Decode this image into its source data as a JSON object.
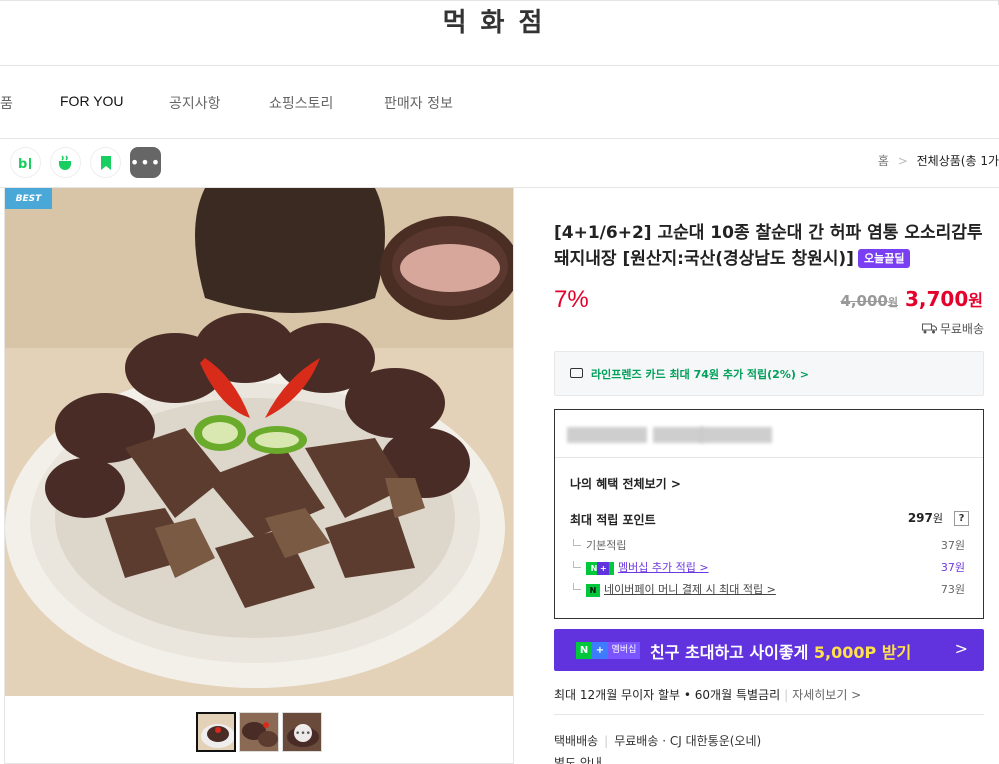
{
  "store": {
    "name": "먹화점"
  },
  "nav": {
    "items": [
      "품",
      "FOR YOU",
      "공지사항",
      "쇼핑스토리",
      "판매자 정보"
    ],
    "active_index": 1
  },
  "share_icons": [
    {
      "name": "blog-icon",
      "label": "b|"
    },
    {
      "name": "cafe-icon",
      "label": ""
    },
    {
      "name": "bookmark-icon",
      "label": ""
    },
    {
      "name": "more-icon",
      "label": "•••"
    }
  ],
  "breadcrumb": {
    "home": "홈",
    "current": "전체상품(총 1가"
  },
  "product": {
    "badge": "BEST",
    "title": "[4+1/6+2] 고순대 10종 찰순대 간 허파 염통 오소리감투 돼지내장 [원산지:국산(경상남도 창원시)]",
    "tag": "오늘끝딜",
    "discount": "7%",
    "original_price": "4,000",
    "original_price_unit": "원",
    "price": "3,700",
    "price_unit": "원",
    "shipping": "무료배송"
  },
  "card_promo": {
    "text": "라인프렌즈 카드 최대 74원 추가 적립(2%) >"
  },
  "benefits": {
    "view_all": "나의 혜택 전체보기 >",
    "max_points_label": "최대 적립 포인트",
    "max_points_value": "297",
    "max_points_unit": "원",
    "help": "?",
    "rows": [
      {
        "label": "기본적립",
        "value": "37원"
      },
      {
        "label": "멤버십 추가 적립 >",
        "value": "37원",
        "badge": "N+"
      },
      {
        "label": "네이버페이 머니 결제 시 최대 적립 >",
        "value": "73원",
        "badge": "N"
      }
    ]
  },
  "banner": {
    "badge_n": "N",
    "badge_plus": "+",
    "badge_label": "멤버십",
    "text_main": "친구 초대하고 사이좋게 ",
    "text_highlight": "5,000P 받기",
    "chevron": ">"
  },
  "installment": {
    "text": "최대 12개월 무이자 할부 • 60개월 특별금리",
    "detail": "자세히보기 >"
  },
  "delivery": {
    "method": "택배배송",
    "fee": "무료배송",
    "carrier": "· CJ 대한통운(오네)",
    "notice": "별도 안내"
  },
  "colors": {
    "price_red": "#e4002b",
    "naver_green": "#00a05a",
    "membership_purple": "#6133df",
    "badge_blue": "#4aa8d9"
  }
}
